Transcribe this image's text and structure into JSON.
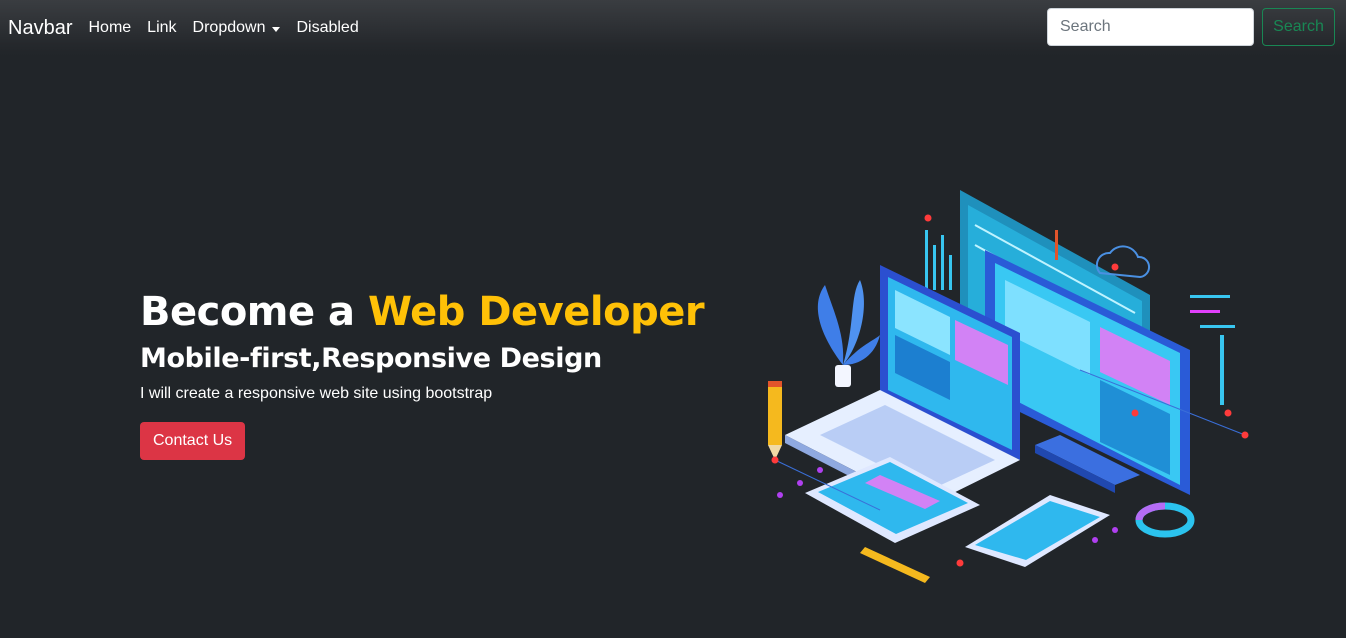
{
  "navbar": {
    "brand": "Navbar",
    "links": [
      {
        "label": "Home"
      },
      {
        "label": "Link"
      },
      {
        "label": "Dropdown"
      },
      {
        "label": "Disabled"
      }
    ],
    "search": {
      "placeholder": "Search",
      "button_label": "Search"
    }
  },
  "hero": {
    "title_prefix": "Become a ",
    "title_highlight": "Web Developer",
    "subtitle": "Mobile-first,Responsive Design",
    "description": "I will create a responsive web site using bootstrap",
    "button_label": "Contact Us"
  },
  "colors": {
    "background": "#212529",
    "accent": "#ffc107",
    "danger": "#dc3545",
    "success": "#198754"
  },
  "illustration": {
    "icon": "web-development-isometric-illustration"
  }
}
